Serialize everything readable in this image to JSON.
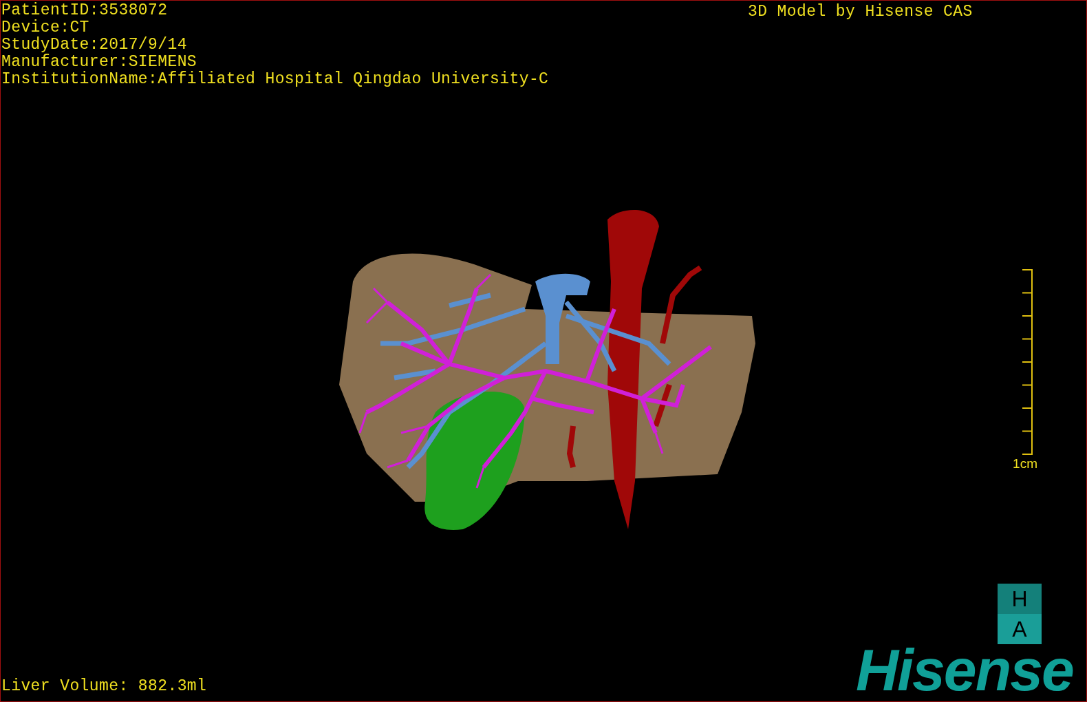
{
  "patient_info": [
    "PatientID:3538072",
    "Device:CT",
    "StudyDate:2017/9/14",
    "Manufacturer:SIEMENS",
    "InstitutionName:Affiliated Hospital Qingdao University-C"
  ],
  "model_credit": "3D Model by Hisense CAS",
  "scale_bar": {
    "label": "1cm"
  },
  "orientation_cube": {
    "top": "H",
    "front": "A"
  },
  "logo": "Hisense",
  "liver_volume": "Liver Volume: 882.3ml"
}
